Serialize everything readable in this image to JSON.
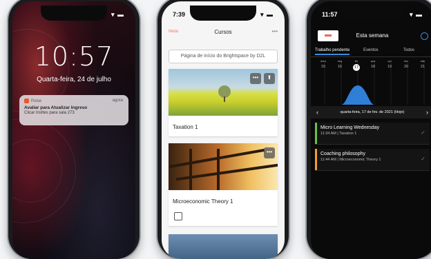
{
  "phone1": {
    "status": {
      "icons": "▾ ▬"
    },
    "lock_time": "10:57",
    "lock_date": "Quarta-feira, 24 de julho",
    "notification": {
      "app": "Pulse",
      "ago": "agora",
      "title": "Avaliar para Atualizar Ingreso",
      "body": "Clicar Insttes para sala 273"
    }
  },
  "phone2": {
    "status": {
      "time": "7:39",
      "icons": "▾ ▬"
    },
    "nav": {
      "back": "Inicio",
      "title": "Cursos",
      "more": "•••"
    },
    "search": "Página de início do Brightspace by D2L",
    "courses": [
      {
        "name": "Taxation 1"
      },
      {
        "name": "Microeconomic Theory 1"
      }
    ],
    "card_buttons": {
      "more": "•••",
      "pin": "⬆"
    }
  },
  "phone3": {
    "status": {
      "time": "11:57",
      "icons": "▾ ▬"
    },
    "header_title": "Esta semana",
    "tabs": [
      "Trabalho pendente",
      "Eventos",
      "Todos"
    ],
    "days": [
      {
        "w": "dom",
        "n": "15"
      },
      {
        "w": "seg",
        "n": "16"
      },
      {
        "w": "ter",
        "n": "17"
      },
      {
        "w": "qua",
        "n": "18"
      },
      {
        "w": "qui",
        "n": "19"
      },
      {
        "w": "sex",
        "n": "20"
      },
      {
        "w": "sáb",
        "n": "21"
      }
    ],
    "date_label": "quarta-feira, 17 de fev. de 2021 (Hoje)",
    "events": [
      {
        "title": "Micro Learning Wednesday",
        "sub": "11:34 AM | Taxation 1",
        "color": "#6cc04a"
      },
      {
        "title": "Coaching philosophy",
        "sub": "11:44 AM | Microeconomic Theory 1",
        "color": "#f0a030"
      }
    ],
    "accent": "#3a8dde"
  }
}
